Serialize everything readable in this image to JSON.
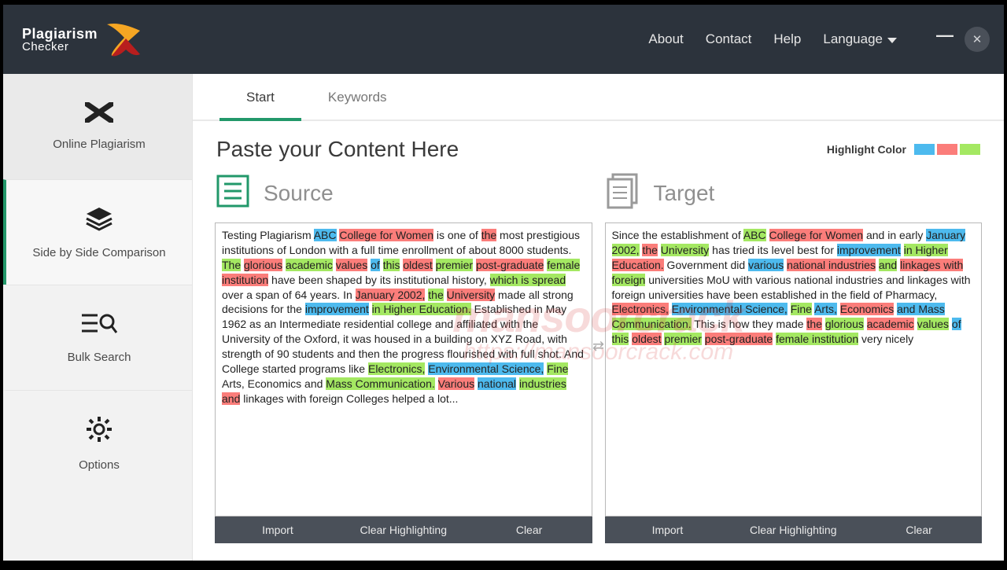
{
  "logo": {
    "line1": "Plagiarism",
    "line2": "Checker"
  },
  "nav": {
    "about": "About",
    "contact": "Contact",
    "help": "Help",
    "language": "Language"
  },
  "sidebar": {
    "items": [
      {
        "label": "Online Plagiarism"
      },
      {
        "label": "Side by Side Comparison"
      },
      {
        "label": "Bulk Search"
      },
      {
        "label": "Options"
      }
    ]
  },
  "tabs": {
    "start": "Start",
    "keywords": "Keywords"
  },
  "title": "Paste your Content Here",
  "highlight_label": "Highlight Color",
  "panels": {
    "source": "Source",
    "target": "Target"
  },
  "actions": {
    "import": "Import",
    "clear_hl": "Clear Highlighting",
    "clear": "Clear"
  },
  "source_segments": [
    {
      "t": "Testing Plagiarism "
    },
    {
      "t": "ABC",
      "c": "b"
    },
    {
      "t": " "
    },
    {
      "t": "College for Women",
      "c": "r"
    },
    {
      "t": " is one of "
    },
    {
      "t": "the",
      "c": "r"
    },
    {
      "t": " most prestigious institutions of London with a full time enrollment of about 8000 students. "
    },
    {
      "t": "The",
      "c": "g"
    },
    {
      "t": " "
    },
    {
      "t": "glorious",
      "c": "r"
    },
    {
      "t": " "
    },
    {
      "t": "academic",
      "c": "g"
    },
    {
      "t": " "
    },
    {
      "t": "values",
      "c": "r"
    },
    {
      "t": " "
    },
    {
      "t": "of",
      "c": "b"
    },
    {
      "t": " "
    },
    {
      "t": "this",
      "c": "g"
    },
    {
      "t": " "
    },
    {
      "t": "oldest",
      "c": "r"
    },
    {
      "t": " "
    },
    {
      "t": "premier",
      "c": "g"
    },
    {
      "t": " "
    },
    {
      "t": "post-graduate",
      "c": "r"
    },
    {
      "t": " "
    },
    {
      "t": "female",
      "c": "g"
    },
    {
      "t": " "
    },
    {
      "t": "institution",
      "c": "r"
    },
    {
      "t": " have been shaped by its institutional history, "
    },
    {
      "t": "which is spread",
      "c": "g"
    },
    {
      "t": " over a span of 64 years. In "
    },
    {
      "t": "January 2002,",
      "c": "r"
    },
    {
      "t": " "
    },
    {
      "t": "the",
      "c": "g"
    },
    {
      "t": " "
    },
    {
      "t": "University",
      "c": "r"
    },
    {
      "t": " made all strong decisions for the "
    },
    {
      "t": "improvement",
      "c": "b"
    },
    {
      "t": " "
    },
    {
      "t": "in Higher Education.",
      "c": "g"
    },
    {
      "t": " Established in May 1962 as an Intermediate residential college and affiliated with the University of the Oxford, it was housed in a building on XYZ Road, with strength of 90 students and then the progress flourished with full shot. And College started programs like "
    },
    {
      "t": "Electronics,",
      "c": "g"
    },
    {
      "t": " "
    },
    {
      "t": "Environmental Science,",
      "c": "b"
    },
    {
      "t": " "
    },
    {
      "t": "Fine",
      "c": "g"
    },
    {
      "t": " Arts, Economics and "
    },
    {
      "t": "Mass Communication.",
      "c": "g"
    },
    {
      "t": " "
    },
    {
      "t": "Various",
      "c": "r"
    },
    {
      "t": " "
    },
    {
      "t": "national",
      "c": "b"
    },
    {
      "t": " "
    },
    {
      "t": "industries",
      "c": "g"
    },
    {
      "t": " "
    },
    {
      "t": "and",
      "c": "r"
    },
    {
      "t": " linkages with foreign Colleges helped a lot..."
    }
  ],
  "target_segments": [
    {
      "t": "Since the establishment of "
    },
    {
      "t": "ABC",
      "c": "g"
    },
    {
      "t": " "
    },
    {
      "t": "College for Women",
      "c": "r"
    },
    {
      "t": " and in early "
    },
    {
      "t": "January",
      "c": "b"
    },
    {
      "t": " "
    },
    {
      "t": "2002,",
      "c": "g"
    },
    {
      "t": " "
    },
    {
      "t": "the",
      "c": "r"
    },
    {
      "t": " "
    },
    {
      "t": "University",
      "c": "g"
    },
    {
      "t": " has tried its level best for "
    },
    {
      "t": "improvement",
      "c": "b"
    },
    {
      "t": " "
    },
    {
      "t": "in Higher",
      "c": "g"
    },
    {
      "t": " "
    },
    {
      "t": "Education.",
      "c": "r"
    },
    {
      "t": " Government did "
    },
    {
      "t": "various",
      "c": "b"
    },
    {
      "t": " "
    },
    {
      "t": "national industries",
      "c": "r"
    },
    {
      "t": " "
    },
    {
      "t": "and",
      "c": "g"
    },
    {
      "t": " "
    },
    {
      "t": "linkages with",
      "c": "r"
    },
    {
      "t": " "
    },
    {
      "t": "foreign",
      "c": "g"
    },
    {
      "t": " universities MoU with various national industries and linkages with foreign universities have been established in the field of Pharmacy, "
    },
    {
      "t": "Electronics,",
      "c": "r"
    },
    {
      "t": " "
    },
    {
      "t": "Environmental Science,",
      "c": "b"
    },
    {
      "t": " "
    },
    {
      "t": "Fine",
      "c": "g"
    },
    {
      "t": " "
    },
    {
      "t": "Arts,",
      "c": "b"
    },
    {
      "t": " "
    },
    {
      "t": "Economics",
      "c": "r"
    },
    {
      "t": " "
    },
    {
      "t": "and Mass",
      "c": "b"
    },
    {
      "t": " "
    },
    {
      "t": "Communication.",
      "c": "g"
    },
    {
      "t": " This is how they made "
    },
    {
      "t": "the",
      "c": "r"
    },
    {
      "t": " "
    },
    {
      "t": "glorious",
      "c": "g"
    },
    {
      "t": " "
    },
    {
      "t": "academic",
      "c": "r"
    },
    {
      "t": " "
    },
    {
      "t": "values",
      "c": "g"
    },
    {
      "t": " "
    },
    {
      "t": "of",
      "c": "b"
    },
    {
      "t": " "
    },
    {
      "t": "this",
      "c": "g"
    },
    {
      "t": " "
    },
    {
      "t": "oldest",
      "c": "r"
    },
    {
      "t": " "
    },
    {
      "t": "premier",
      "c": "g"
    },
    {
      "t": " "
    },
    {
      "t": "post-graduate",
      "c": "r"
    },
    {
      "t": " "
    },
    {
      "t": "female institution",
      "c": "g"
    },
    {
      "t": " very nicely"
    }
  ]
}
